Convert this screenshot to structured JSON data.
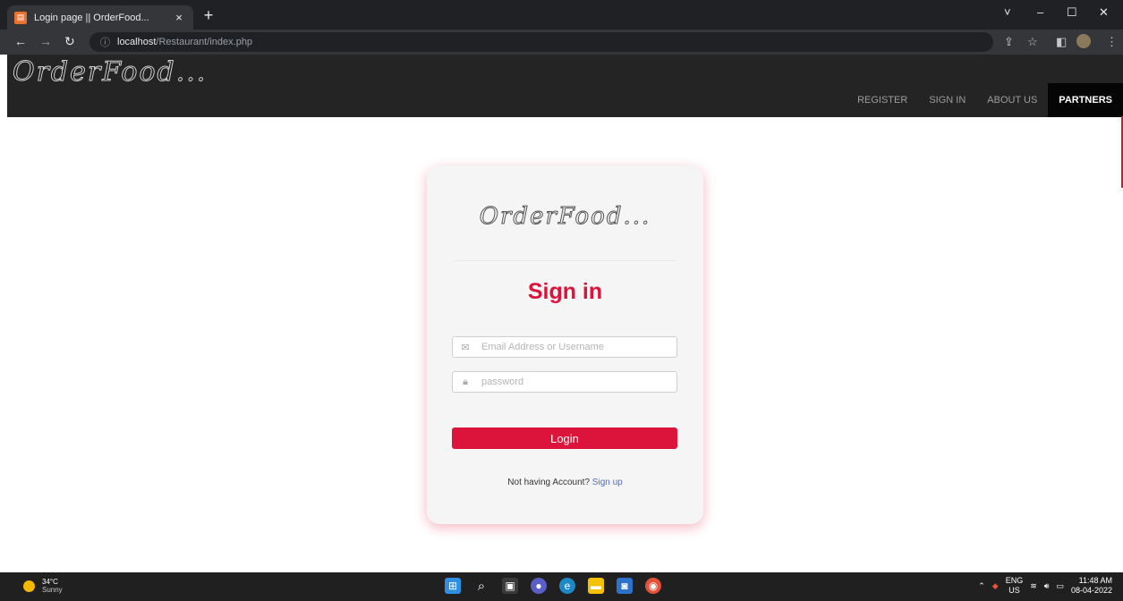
{
  "browser": {
    "tab_title": "Login page || OrderFood...",
    "tab_close": "×",
    "new_tab": "+",
    "url_host": "localhost",
    "url_path": "/Restaurant/index.php",
    "window_controls": [
      "˅",
      "–",
      "☐",
      "✕"
    ]
  },
  "site": {
    "brand": "OrderFood...",
    "nav": [
      "REGISTER",
      "SIGN IN",
      "ABOUT US",
      "PARTNERS"
    ],
    "active_nav": "PARTNERS"
  },
  "login": {
    "brand": "OrderFood...",
    "title": "Sign in",
    "email_placeholder": "Email Address or Username",
    "password_placeholder": "password",
    "login_label": "Login",
    "signup_prompt": "Not having Account?",
    "signup_link": "Sign up"
  },
  "taskbar": {
    "weather_temp": "34°C",
    "weather_condition": "Sunny",
    "lang_top": "ENG",
    "lang_bottom": "US",
    "time": "11:48 AM",
    "date": "08-04-2022"
  },
  "colors": {
    "accent": "#dc143c",
    "header_bg": "#242424",
    "link": "#4a6fd1"
  }
}
